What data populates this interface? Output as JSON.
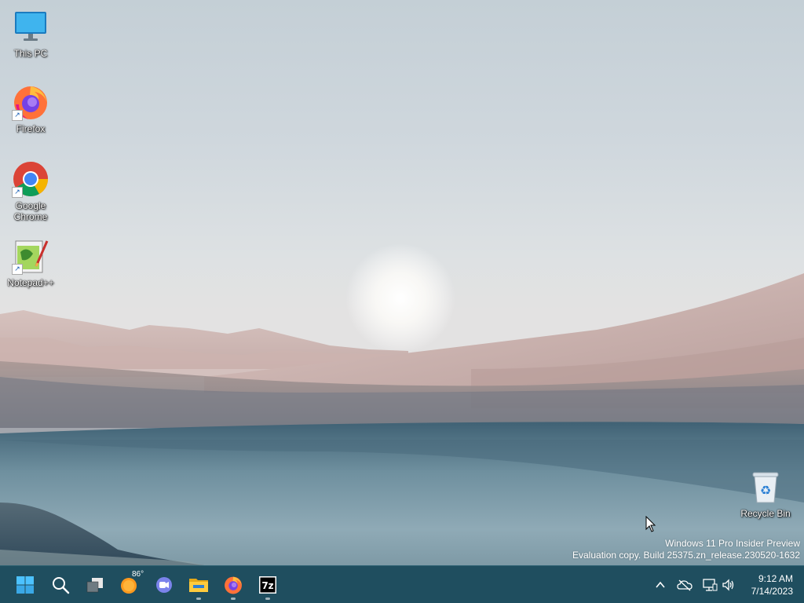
{
  "desktop": {
    "icons": [
      {
        "label": "This PC",
        "icon": "monitor-icon",
        "shortcut": false
      },
      {
        "label": "Firefox",
        "icon": "firefox-icon",
        "shortcut": true
      },
      {
        "label": "Google Chrome",
        "icon": "chrome-icon",
        "shortcut": true
      },
      {
        "label": "Notepad++",
        "icon": "notepadpp-icon",
        "shortcut": true
      },
      {
        "label": "Recycle Bin",
        "icon": "recycle-bin-icon",
        "shortcut": false
      }
    ],
    "watermark": {
      "line1": "Windows 11 Pro Insider Preview",
      "line2": "Evaluation copy. Build 25375.zn_release.230520-1632"
    }
  },
  "taskbar": {
    "background": "#1f4e5f",
    "weather": {
      "temp": "86°"
    },
    "apps": [
      {
        "icon": "windows-start-icon",
        "running": false
      },
      {
        "icon": "search-icon",
        "running": false
      },
      {
        "icon": "task-view-icon",
        "running": false
      },
      {
        "icon": "weather-icon",
        "running": false
      },
      {
        "icon": "teams-chat-icon",
        "running": false
      },
      {
        "icon": "file-explorer-icon",
        "running": true
      },
      {
        "icon": "firefox-icon",
        "running": true
      },
      {
        "icon": "7zip-icon",
        "running": true
      }
    ],
    "tray": {
      "icons": [
        "chevron-up-icon",
        "onedrive-offline-icon",
        "network-icon",
        "volume-icon"
      ]
    },
    "clock": {
      "time": "9:12 AM",
      "date": "7/14/2023"
    }
  }
}
